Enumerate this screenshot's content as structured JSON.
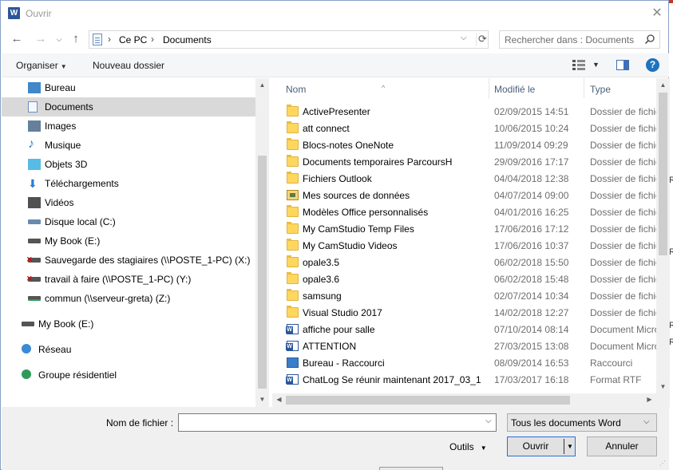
{
  "window": {
    "title": "Ouvrir",
    "app_icon": "word-icon",
    "accent": "#2b579a"
  },
  "address": {
    "segments": [
      "Ce PC",
      "Documents"
    ],
    "search_placeholder": "Rechercher dans : Documents"
  },
  "toolbar": {
    "organize_label": "Organiser",
    "new_folder_label": "Nouveau dossier",
    "help_label": "?"
  },
  "nav": {
    "items": [
      {
        "label": "Bureau",
        "icon": "desktop-icon"
      },
      {
        "label": "Documents",
        "icon": "documents-icon",
        "selected": true
      },
      {
        "label": "Images",
        "icon": "pictures-icon"
      },
      {
        "label": "Musique",
        "icon": "music-icon"
      },
      {
        "label": "Objets 3D",
        "icon": "3d-objects-icon"
      },
      {
        "label": "Téléchargements",
        "icon": "downloads-icon"
      },
      {
        "label": "Vidéos",
        "icon": "videos-icon"
      },
      {
        "label": "Disque local (C:)",
        "icon": "local-disk-icon"
      },
      {
        "label": "My Book (E:)",
        "icon": "drive-icon"
      },
      {
        "label": "Sauvegarde des stagiaires (\\\\POSTE_1-PC) (X:)",
        "icon": "network-drive-disconnected-icon"
      },
      {
        "label": "travail à faire (\\\\POSTE_1-PC) (Y:)",
        "icon": "network-drive-disconnected-icon"
      },
      {
        "label": "commun (\\\\serveur-greta) (Z:)",
        "icon": "network-drive-icon"
      },
      {
        "label": "My Book (E:)",
        "icon": "drive-icon"
      },
      {
        "label": "Réseau",
        "icon": "network-icon"
      },
      {
        "label": "Groupe résidentiel",
        "icon": "homegroup-icon"
      }
    ]
  },
  "columns": {
    "name": "Nom",
    "modified": "Modifié le",
    "type": "Type"
  },
  "files": [
    {
      "name": "ActivePresenter",
      "date": "02/09/2015 14:51",
      "type": "Dossier de fichiers",
      "kind": "folder"
    },
    {
      "name": "att connect",
      "date": "10/06/2015 10:24",
      "type": "Dossier de fichiers",
      "kind": "folder"
    },
    {
      "name": "Blocs-notes OneNote",
      "date": "11/09/2014 09:29",
      "type": "Dossier de fichiers",
      "kind": "folder"
    },
    {
      "name": "Documents temporaires ParcoursH",
      "date": "29/09/2016 17:17",
      "type": "Dossier de fichiers",
      "kind": "folder"
    },
    {
      "name": "Fichiers Outlook",
      "date": "04/04/2018 12:38",
      "type": "Dossier de fichiers",
      "kind": "folder"
    },
    {
      "name": "Mes sources de données",
      "date": "04/07/2014 09:00",
      "type": "Dossier de fichiers",
      "kind": "datasrc"
    },
    {
      "name": "Modèles Office personnalisés",
      "date": "04/01/2016 16:25",
      "type": "Dossier de fichiers",
      "kind": "folder"
    },
    {
      "name": "My CamStudio Temp Files",
      "date": "17/06/2016 17:12",
      "type": "Dossier de fichiers",
      "kind": "folder"
    },
    {
      "name": "My CamStudio Videos",
      "date": "17/06/2016 10:37",
      "type": "Dossier de fichiers",
      "kind": "folder"
    },
    {
      "name": "opale3.5",
      "date": "06/02/2018 15:50",
      "type": "Dossier de fichiers",
      "kind": "folder"
    },
    {
      "name": "opale3.6",
      "date": "06/02/2018 15:48",
      "type": "Dossier de fichiers",
      "kind": "folder"
    },
    {
      "name": "samsung",
      "date": "02/07/2014 10:34",
      "type": "Dossier de fichiers",
      "kind": "folder"
    },
    {
      "name": "Visual Studio 2017",
      "date": "14/02/2018 12:27",
      "type": "Dossier de fichiers",
      "kind": "folder"
    },
    {
      "name": "affiche pour salle",
      "date": "07/10/2014 08:14",
      "type": "Document Microsoft",
      "kind": "worddoc"
    },
    {
      "name": "ATTENTION",
      "date": "27/03/2015 13:08",
      "type": "Document Microsoft",
      "kind": "worddoc"
    },
    {
      "name": "Bureau - Raccourci",
      "date": "08/09/2014 16:53",
      "type": "Raccourci",
      "kind": "shortcut"
    },
    {
      "name": "ChatLog Se réunir maintenant 2017_03_1...",
      "date": "17/03/2017 16:18",
      "type": "Format RTF",
      "kind": "rtfdoc"
    }
  ],
  "footer": {
    "filename_label": "Nom de fichier :",
    "filename_value": "",
    "filter_value": "Tous les documents Word",
    "tools_label": "Outils",
    "open_label": "Ouvrir",
    "cancel_label": "Annuler"
  },
  "background_window": {
    "fragments": [
      "Ri",
      "Ri",
      "Ri",
      "Ri"
    ]
  }
}
